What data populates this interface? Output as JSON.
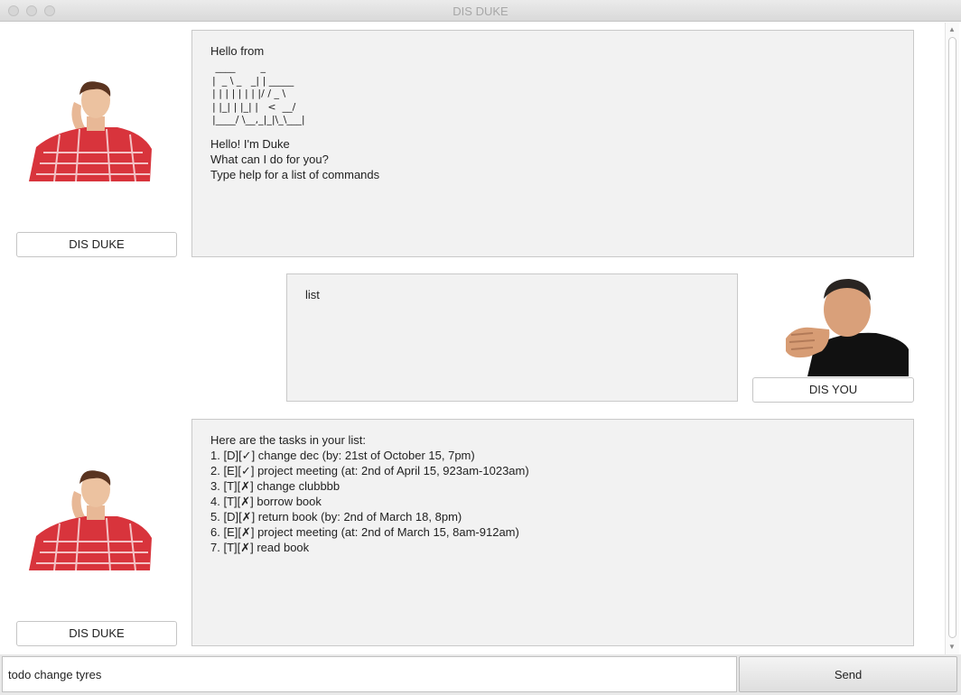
{
  "window": {
    "title": "DIS DUKE"
  },
  "messages": [
    {
      "sender": "DIS DUKE",
      "intro": "Hello from",
      "logo": " ____        _\n|  _ \\ _   _| | _____\n| | | | | | | |/ / _ \\\n| |_| | |_| |   <  __/\n|____/ \\__,_|_|\\_\\___|",
      "body": "Hello! I'm Duke\nWhat can I do for you?\nType help for a list of commands"
    },
    {
      "sender": "DIS YOU",
      "body": "list"
    },
    {
      "sender": "DIS DUKE",
      "body": "Here are the tasks in your list:\n1. [D][✓] change dec (by: 21st of October 15, 7pm)\n2. [E][✓] project meeting (at: 2nd of April 15, 923am-1023am)\n3. [T][✗] change clubbbb\n4. [T][✗] borrow book\n5. [D][✗] return book (by: 2nd of March 18, 8pm)\n6. [E][✗] project meeting (at: 2nd of March 15, 8am-912am)\n7. [T][✗] read book"
    }
  ],
  "input": {
    "value": "todo change tyres",
    "send_label": "Send"
  }
}
